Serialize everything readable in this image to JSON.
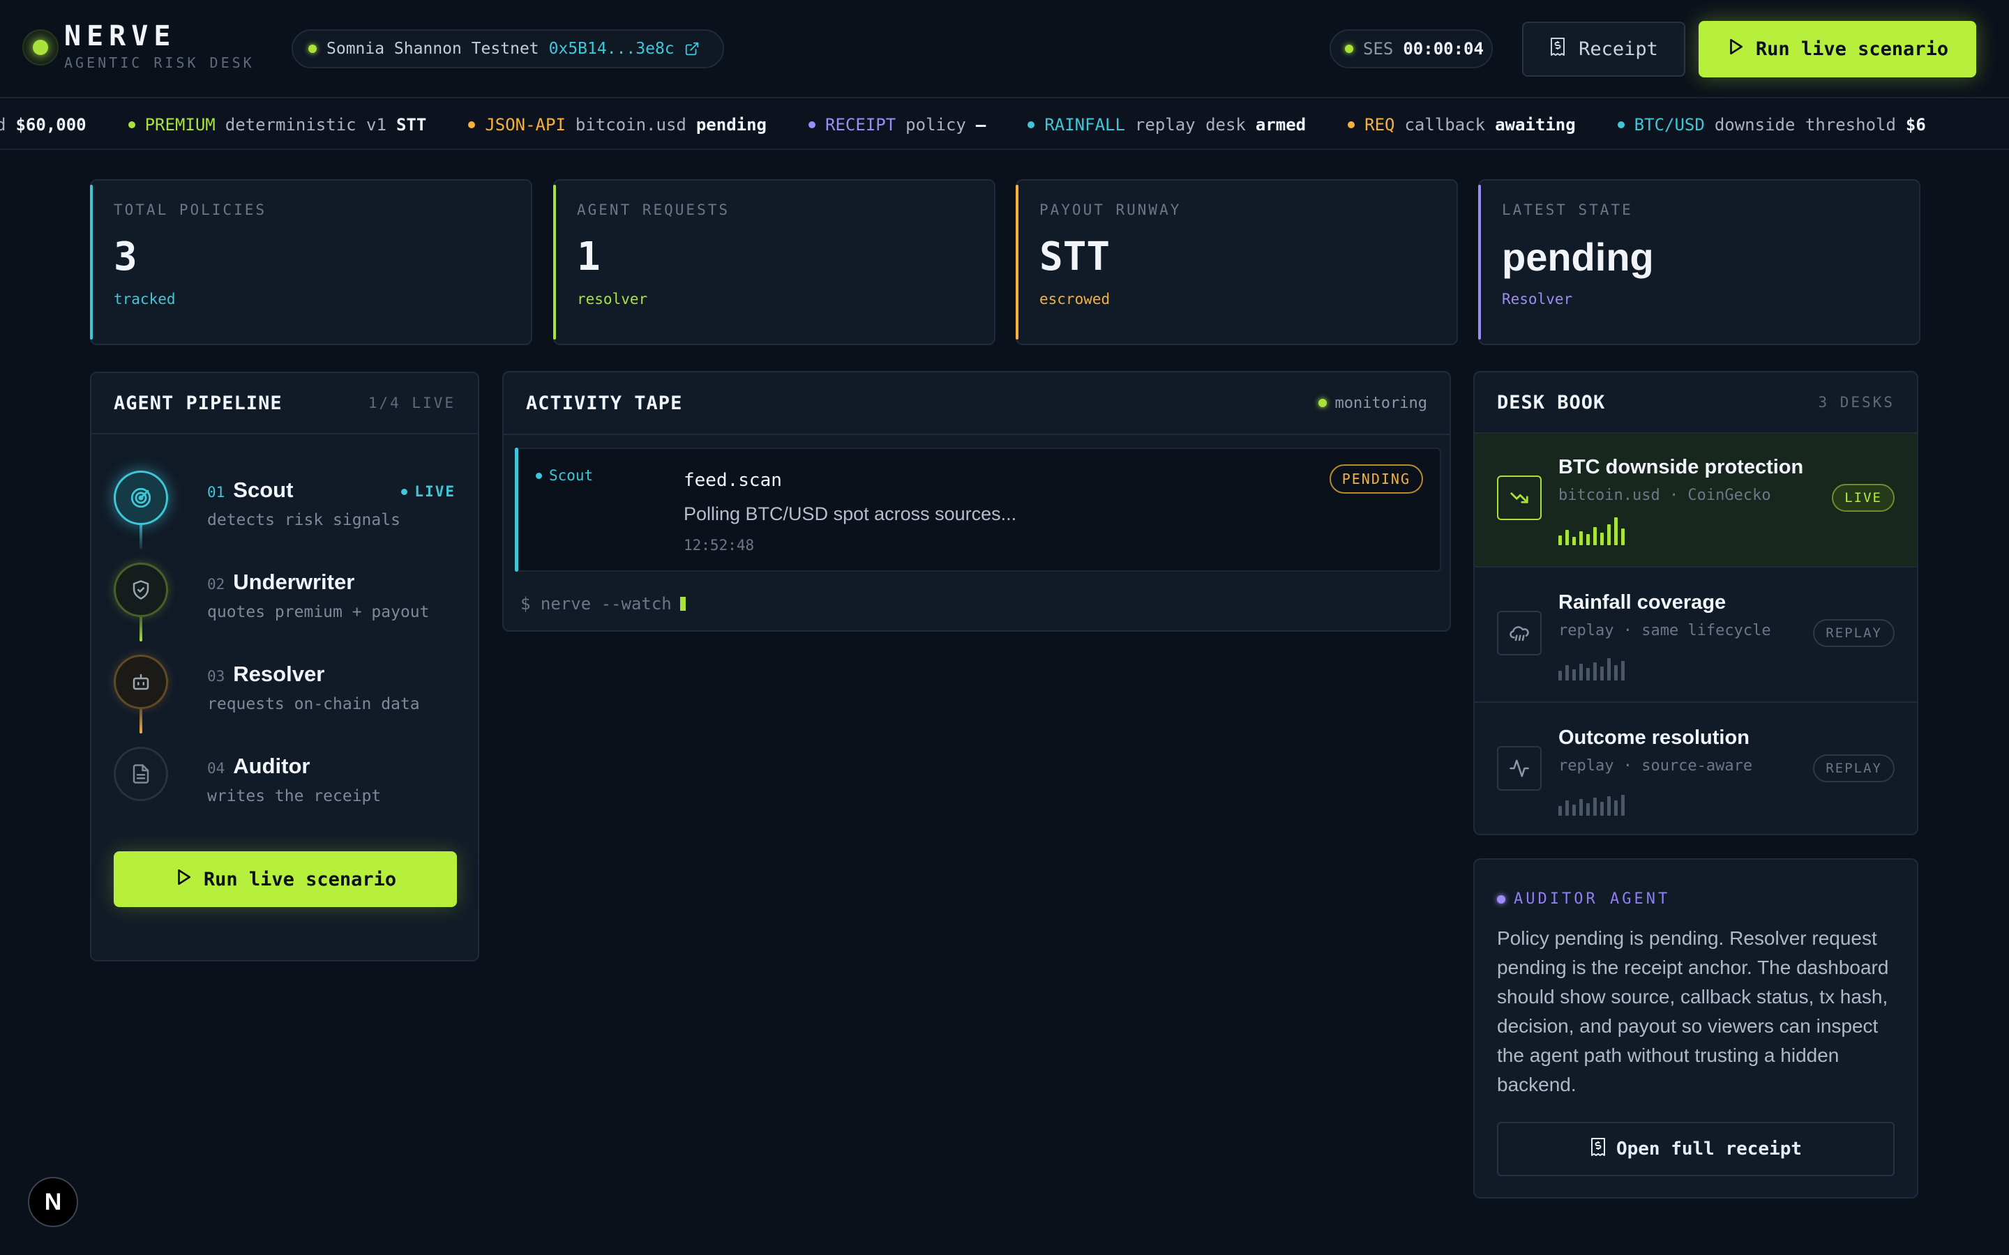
{
  "header": {
    "brand": "NERVE",
    "tagline": "AGENTIC RISK DESK",
    "network": "Somnia Shannon Testnet",
    "address": "0x5B14...3e8c",
    "session_label": "SES",
    "session_time": "00:00:04",
    "receipt_label": "Receipt",
    "run_label": "Run live scenario"
  },
  "ticker": [
    {
      "tag": "",
      "text": "d",
      "value": "$60,000",
      "color": "#a8b2c0"
    },
    {
      "tag": "PREMIUM",
      "text": "deterministic v1",
      "value": "STT",
      "color": "#a8e23a"
    },
    {
      "tag": "JSON-API",
      "text": "bitcoin.usd",
      "value": "pending",
      "color": "#f5b03e"
    },
    {
      "tag": "RECEIPT",
      "text": "policy",
      "value": "—",
      "color": "#9d8cf5"
    },
    {
      "tag": "RAINFALL",
      "text": "replay desk",
      "value": "armed",
      "color": "#3fc7d9"
    },
    {
      "tag": "REQ",
      "text": "callback",
      "value": "awaiting",
      "color": "#f5b03e"
    },
    {
      "tag": "BTC/USD",
      "text": "downside threshold",
      "value": "$6",
      "color": "#3fc7d9"
    }
  ],
  "stats": [
    {
      "label": "TOTAL POLICIES",
      "value": "3",
      "sub": "tracked",
      "color": "#3fc7d9"
    },
    {
      "label": "AGENT REQUESTS",
      "value": "1",
      "sub": "resolver",
      "color": "#a8e23a"
    },
    {
      "label": "PAYOUT RUNWAY",
      "value": "STT",
      "sub": "escrowed",
      "color": "#f5b03e"
    },
    {
      "label": "LATEST STATE",
      "value": "pending",
      "sub": "Resolver",
      "color": "#9d8cf5"
    }
  ],
  "pipeline": {
    "title": "AGENT PIPELINE",
    "meta": "1/4 LIVE",
    "live_tag": "LIVE",
    "steps": [
      {
        "num": "01",
        "name": "Scout",
        "desc": "detects risk signals",
        "color": "#3fc7d9"
      },
      {
        "num": "02",
        "name": "Underwriter",
        "desc": "quotes premium + payout",
        "color": "#a8e23a"
      },
      {
        "num": "03",
        "name": "Resolver",
        "desc": "requests on-chain data",
        "color": "#f5b03e"
      },
      {
        "num": "04",
        "name": "Auditor",
        "desc": "writes the receipt",
        "color": "#6b7787"
      }
    ],
    "run_label": "Run live scenario"
  },
  "activity": {
    "title": "ACTIVITY TAPE",
    "status": "monitoring",
    "entry": {
      "agent": "Scout",
      "event": "feed.scan",
      "message": "Polling BTC/USD spot across sources...",
      "time": "12:52:48",
      "badge": "PENDING"
    },
    "prompt": "$ nerve --watch"
  },
  "deskbook": {
    "title": "DESK BOOK",
    "meta": "3 DESKS",
    "desks": [
      {
        "title": "BTC downside protection",
        "sub": "bitcoin.usd · CoinGecko",
        "badge": "LIVE",
        "icon": "trending-down-icon",
        "bar_levels": [
          0.35,
          0.55,
          0.3,
          0.5,
          0.4,
          0.65,
          0.45,
          0.75,
          1.0,
          0.6
        ]
      },
      {
        "title": "Rainfall coverage",
        "sub": "replay · same lifecycle",
        "badge": "REPLAY",
        "icon": "cloud-rain-icon",
        "bar_levels": [
          0.35,
          0.55,
          0.4,
          0.6,
          0.45,
          0.65,
          0.5,
          0.8,
          0.55,
          0.7
        ]
      },
      {
        "title": "Outcome resolution",
        "sub": "replay · source-aware",
        "badge": "REPLAY",
        "icon": "activity-icon",
        "bar_levels": [
          0.35,
          0.55,
          0.4,
          0.6,
          0.45,
          0.65,
          0.5,
          0.7,
          0.55,
          0.75
        ]
      }
    ]
  },
  "auditor": {
    "label": "AUDITOR AGENT",
    "text": "Policy pending is pending. Resolver request pending is the receipt anchor. The dashboard should show source, callback status, tx hash, decision, and payout so viewers can inspect the agent path without trusting a hidden backend.",
    "button": "Open full receipt"
  },
  "colors": {
    "accent": "#b7f03c",
    "cyan": "#3fc7d9",
    "amber": "#f5b03e",
    "violet": "#9d8cf5",
    "background": "#0b111b"
  }
}
